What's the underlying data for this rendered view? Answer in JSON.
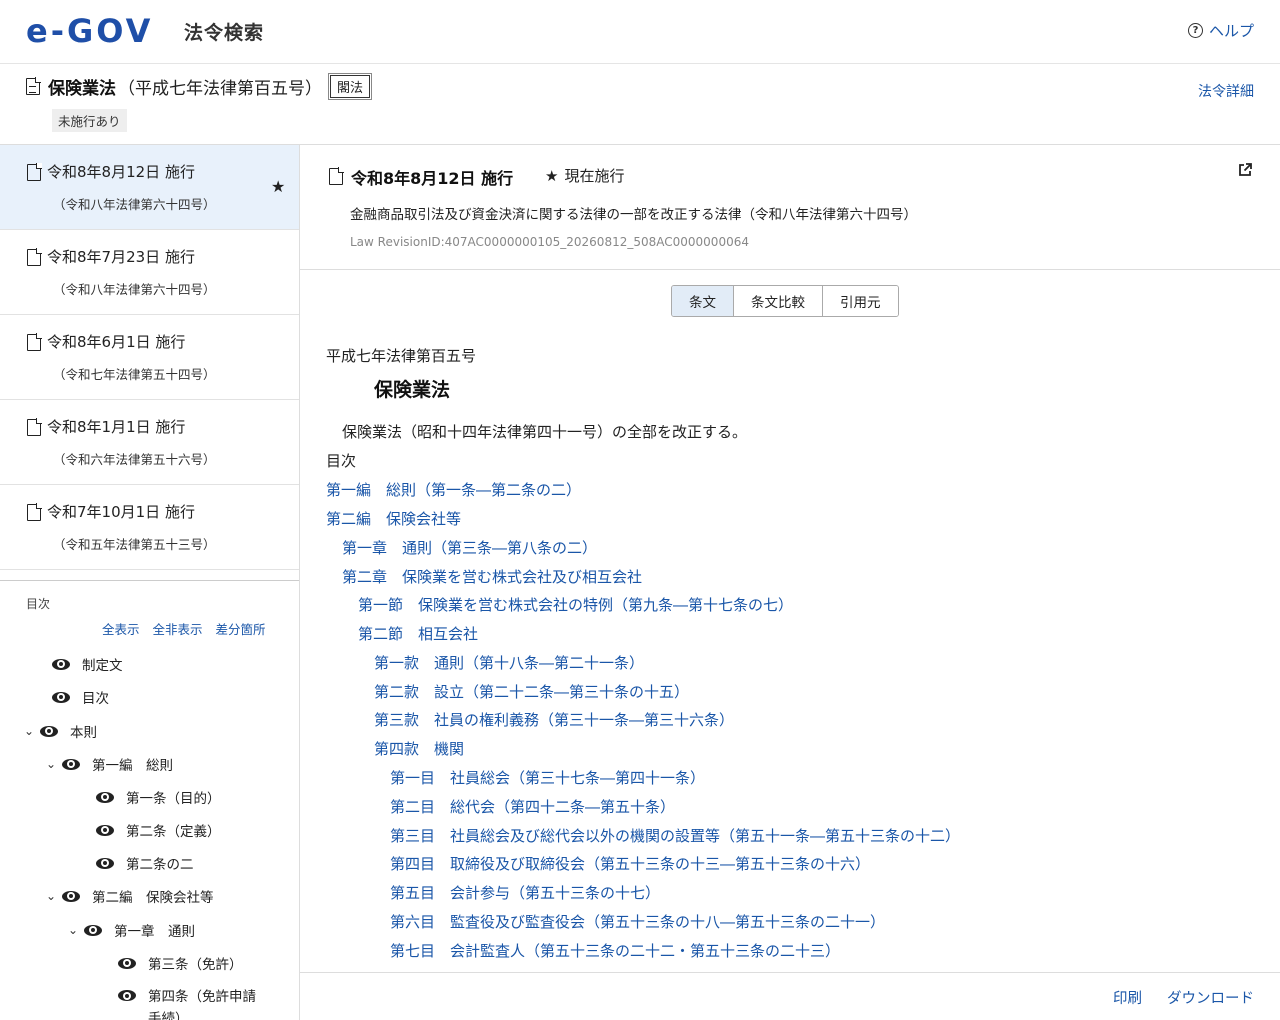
{
  "header": {
    "logo_text": "e-GOV",
    "site_title": "法令検索",
    "help_label": "ヘルプ"
  },
  "law": {
    "name": "保険業法",
    "number_paren": "（平成七年法律第百五号）",
    "kind_badge": "閣法",
    "unenforced_tag": "未施行あり",
    "detail_link": "法令詳細"
  },
  "revisions": [
    {
      "date": "令和8年8月12日 施行",
      "sub": "（令和八年法律第六十四号）"
    },
    {
      "date": "令和8年7月23日 施行",
      "sub": "（令和八年法律第六十四号）"
    },
    {
      "date": "令和8年6月1日 施行",
      "sub": "（令和七年法律第五十四号）"
    },
    {
      "date": "令和8年1月1日 施行",
      "sub": "（令和六年法律第五十六号）"
    },
    {
      "date": "令和7年10月1日 施行",
      "sub": "（令和五年法律第五十三号）"
    }
  ],
  "sidebar_toc": {
    "label": "目次",
    "show_all": "全表示",
    "hide_all": "全非表示",
    "diff": "差分箇所",
    "nodes": [
      "制定文",
      "目次",
      "本則",
      "第一編　総則",
      "第一条（目的）",
      "第二条（定義）",
      "第二条の二",
      "第二編　保険会社等",
      "第一章　通則",
      "第三条（免許）",
      "第四条（免許申請手続）"
    ]
  },
  "main": {
    "date": "令和8年8月12日 施行",
    "status": "現在施行",
    "amend_law": "金融商品取引法及び資金決済に関する法律の一部を改正する法律（令和八年法律第六十四号）",
    "revision_id": "Law RevisionID:407AC0000000105_20260812_508AC0000000064",
    "tabs": [
      "条文",
      "条文比較",
      "引用元"
    ],
    "body_number": "平成七年法律第百五号",
    "body_title": "保険業法",
    "preamble": "保険業法（昭和十四年法律第四十一号）の全部を改正する。",
    "toc_heading": "目次",
    "toc_links": [
      "第一編　総則（第一条―第二条の二）",
      "第二編　保険会社等",
      "第一章　通則（第三条―第八条の二）",
      "第二章　保険業を営む株式会社及び相互会社",
      "第一節　保険業を営む株式会社の特例（第九条―第十七条の七）",
      "第二節　相互会社",
      "第一款　通則（第十八条―第二十一条）",
      "第二款　設立（第二十二条―第三十条の十五）",
      "第三款　社員の権利義務（第三十一条―第三十六条）",
      "第四款　機関",
      "第一目　社員総会（第三十七条―第四十一条）",
      "第二目　総代会（第四十二条―第五十条）",
      "第三目　社員総会及び総代会以外の機関の設置等（第五十一条―第五十三条の十二）",
      "第四目　取締役及び取締役会（第五十三条の十三―第五十三条の十六）",
      "第五目　会計参与（第五十三条の十七）",
      "第六目　監査役及び監査役会（第五十三条の十八―第五十三条の二十一）",
      "第七目　会計監査人（第五十三条の二十二・第五十三条の二十三）"
    ]
  },
  "footer": {
    "print": "印刷",
    "download": "ダウンロード"
  }
}
